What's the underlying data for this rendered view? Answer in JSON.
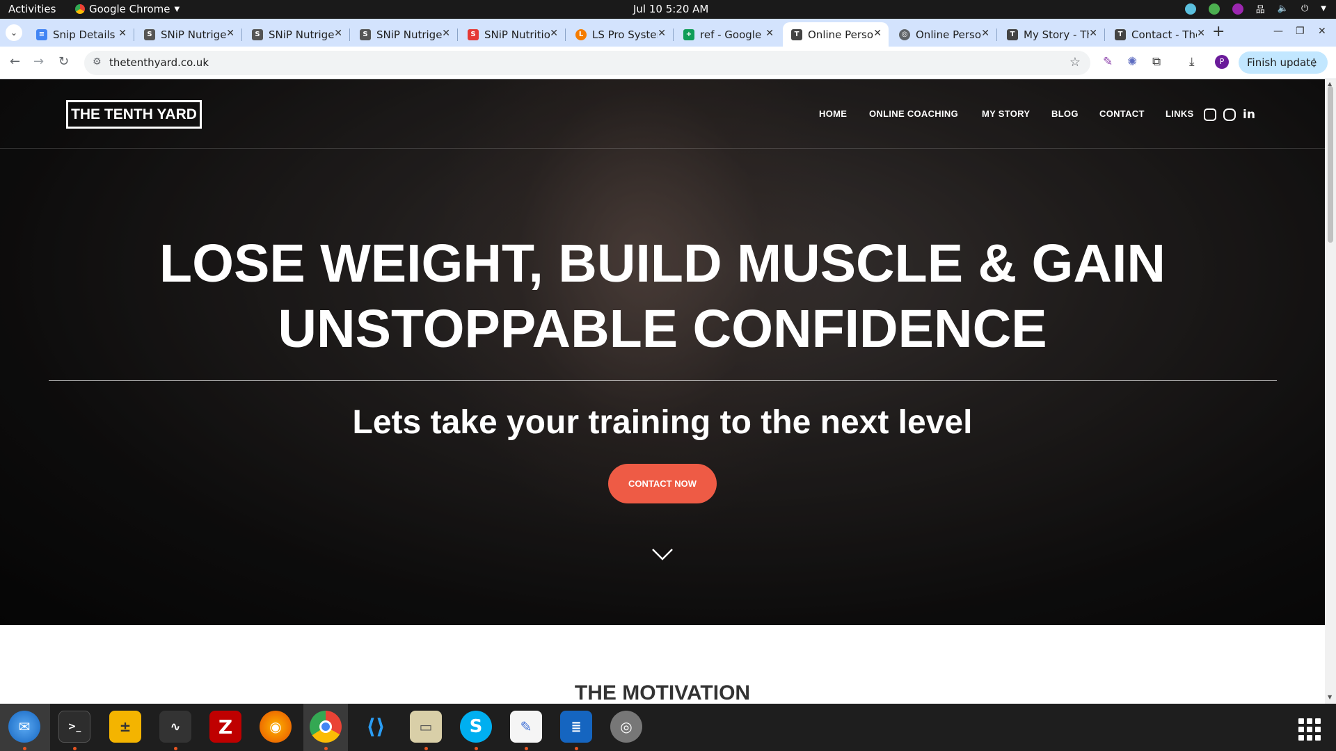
{
  "system": {
    "activities": "Activities",
    "app_name": "Google Chrome",
    "clock": "Jul 10  5:20 AM"
  },
  "browser": {
    "tabs": [
      {
        "title": "Snip Details",
        "favicon": "docs-icon",
        "color": "#4285f4"
      },
      {
        "title": "SNiP Nutrigenomics",
        "favicon": "snip-icon",
        "color": "#555555"
      },
      {
        "title": "SNiP Nutrigenomics",
        "favicon": "snip-icon",
        "color": "#555555"
      },
      {
        "title": "SNiP Nutrigenomics",
        "favicon": "snip-icon",
        "color": "#555555"
      },
      {
        "title": "SNiP Nutrition",
        "favicon": "snip-red-icon",
        "color": "#e53935"
      },
      {
        "title": "LS Pro System",
        "favicon": "ls-icon",
        "color": "#f57c00"
      },
      {
        "title": "ref - Google Sheets",
        "favicon": "sheets-icon",
        "color": "#0f9d58"
      },
      {
        "title": "Online Personal",
        "favicon": "tenthyard-icon",
        "color": "#444444"
      },
      {
        "title": "Online Personal",
        "favicon": "globe-icon",
        "color": "#5f6368"
      },
      {
        "title": "My Story - The",
        "favicon": "tenthyard-icon",
        "color": "#444444"
      },
      {
        "title": "Contact - The",
        "favicon": "tenthyard-icon",
        "color": "#444444"
      }
    ],
    "active_tab": 7,
    "url": "thetenthyard.co.uk",
    "finish_update": "Finish update",
    "profile_initial": "P"
  },
  "site": {
    "logo": "THE TENTH YARD",
    "nav": [
      "HOME",
      "ONLINE COACHING",
      "MY STORY",
      "BLOG",
      "CONTACT",
      "LINKS"
    ],
    "social": [
      "instagram-icon",
      "youtube-icon",
      "linkedin-icon"
    ],
    "headline_1": "LOSE WEIGHT, BUILD MUSCLE & GAIN",
    "headline_2": "UNSTOPPABLE CONFIDENCE",
    "subhead": "Lets take your training to the next level",
    "cta": "CONTACT NOW",
    "section_title": "THE MOTIVATION",
    "accent": "#ee5b45"
  },
  "dock": [
    "thunderbird-icon",
    "terminal-icon",
    "calculator-icon",
    "system-monitor-icon",
    "filezilla-icon",
    "firefox-icon",
    "chrome-icon",
    "vscode-icon",
    "files-icon",
    "skype-icon",
    "text-editor-icon",
    "writer-icon",
    "disks-icon"
  ]
}
